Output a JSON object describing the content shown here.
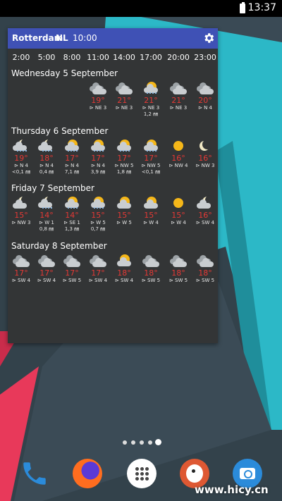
{
  "status_bar": {
    "time": "13:37"
  },
  "widget": {
    "city": "Rotterdam",
    "country": "NL",
    "updated": "10:00",
    "hours": [
      "2:00",
      "5:00",
      "8:00",
      "11:00",
      "14:00",
      "17:00",
      "20:00",
      "23:00"
    ],
    "days": [
      {
        "title": "Wednesday 5 September",
        "forecasts": [
          null,
          null,
          null,
          {
            "icon": "cloudy-icon",
            "temp": "19°",
            "wind": "⊳ NE 3",
            "rain": ""
          },
          {
            "icon": "cloudy-icon",
            "temp": "21°",
            "wind": "⊳ NE 3",
            "rain": ""
          },
          {
            "icon": "sun-cloud-rain-icon",
            "temp": "21°",
            "wind": "⊳ NE 3",
            "rain": "1,2 ㎜"
          },
          {
            "icon": "cloudy-icon",
            "temp": "21°",
            "wind": "⊳ NE 3",
            "rain": ""
          },
          {
            "icon": "cloudy-icon",
            "temp": "20°",
            "wind": "⊳ N 4",
            "rain": ""
          }
        ]
      },
      {
        "title": "Thursday 6 September",
        "forecasts": [
          {
            "icon": "moon-cloud-rain-icon",
            "temp": "19°",
            "wind": "⊳ N 4",
            "rain": "<0,1 ㎜"
          },
          {
            "icon": "moon-cloud-rain-icon",
            "temp": "18°",
            "wind": "⊳ N 4",
            "rain": "0,4 ㎜"
          },
          {
            "icon": "sun-cloud-rain-icon",
            "temp": "17°",
            "wind": "⊳ N 4",
            "rain": "7,1 ㎜"
          },
          {
            "icon": "sun-cloud-rain-icon",
            "temp": "17°",
            "wind": "⊳ N 4",
            "rain": "3,9 ㎜"
          },
          {
            "icon": "sun-cloud-rain-icon",
            "temp": "17°",
            "wind": "⊳ NW 5",
            "rain": "1,8 ㎜"
          },
          {
            "icon": "sun-cloud-rain-icon",
            "temp": "17°",
            "wind": "⊳ NW 5",
            "rain": "<0,1 ㎜"
          },
          {
            "icon": "sun-icon",
            "temp": "16°",
            "wind": "⊳ NW 4",
            "rain": ""
          },
          {
            "icon": "moon-icon",
            "temp": "16°",
            "wind": "⊳ NW 3",
            "rain": ""
          }
        ]
      },
      {
        "title": "Friday 7 September",
        "forecasts": [
          {
            "icon": "moon-cloud-icon",
            "temp": "15°",
            "wind": "⊳ NW 3",
            "rain": ""
          },
          {
            "icon": "moon-cloud-rain-icon",
            "temp": "14°",
            "wind": "⊳ W 1",
            "rain": "0,8 ㎜"
          },
          {
            "icon": "sun-cloud-rain-icon",
            "temp": "14°",
            "wind": "⊳ SE 1",
            "rain": "1,3 ㎜"
          },
          {
            "icon": "sun-cloud-rain-icon",
            "temp": "15°",
            "wind": "⊳ W 5",
            "rain": "0,7 ㎜"
          },
          {
            "icon": "sun-cloud-icon",
            "temp": "15°",
            "wind": "⊳ W 5",
            "rain": ""
          },
          {
            "icon": "sun-cloud-icon",
            "temp": "15°",
            "wind": "⊳ W 4",
            "rain": ""
          },
          {
            "icon": "sun-icon",
            "temp": "15°",
            "wind": "⊳ W 4",
            "rain": ""
          },
          {
            "icon": "moon-cloud-icon",
            "temp": "16°",
            "wind": "⊳ SW 4",
            "rain": ""
          }
        ]
      },
      {
        "title": "Saturday 8 September",
        "forecasts": [
          {
            "icon": "cloudy-icon",
            "temp": "17°",
            "wind": "⊳ SW 4",
            "rain": ""
          },
          {
            "icon": "cloudy-icon",
            "temp": "17°",
            "wind": "⊳ SW 4",
            "rain": ""
          },
          {
            "icon": "cloudy-icon",
            "temp": "17°",
            "wind": "⊳ SW 5",
            "rain": ""
          },
          {
            "icon": "cloudy-icon",
            "temp": "17°",
            "wind": "⊳ SW 4",
            "rain": ""
          },
          {
            "icon": "sun-cloud-icon",
            "temp": "18°",
            "wind": "⊳ SW 4",
            "rain": ""
          },
          {
            "icon": "cloudy-icon",
            "temp": "18°",
            "wind": "⊳ SW 5",
            "rain": ""
          },
          {
            "icon": "cloudy-icon",
            "temp": "18°",
            "wind": "⊳ SW 5",
            "rain": ""
          },
          {
            "icon": "cloudy-icon",
            "temp": "18°",
            "wind": "⊳ SW 5",
            "rain": ""
          }
        ]
      }
    ]
  },
  "dock": {
    "icons": [
      "phone-icon",
      "firefox-icon",
      "app-drawer-icon",
      "duckduckgo-icon",
      "camera-icon"
    ]
  },
  "watermark": "www.hicy.cn",
  "colors": {
    "header": "#3f51b5",
    "widget_bg": "#333536",
    "temperature": "#e53935",
    "wallpaper_teal": "#2cb8c7",
    "wallpaper_red": "#e8395a"
  }
}
